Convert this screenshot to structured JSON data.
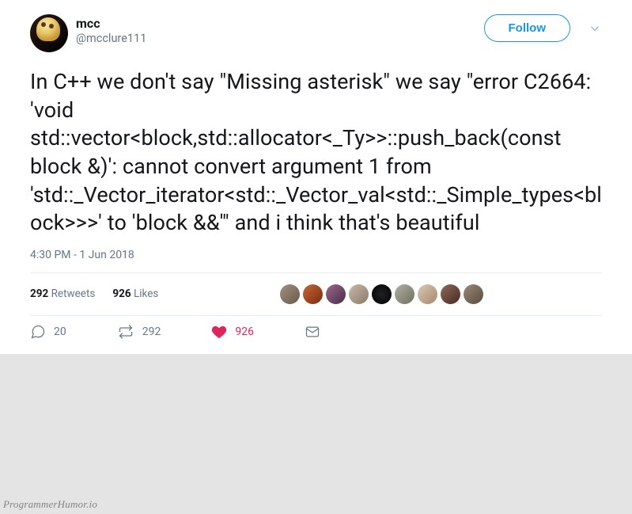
{
  "header": {
    "display_name": "mcc",
    "handle": "@mcclure111",
    "follow_label": "Follow"
  },
  "tweet": {
    "text": "In C++ we don't say \"Missing asterisk\" we say \"error C2664: 'void std::vector<block,std::allocator<_Ty>>::push_back(const block &)': cannot convert argument 1 from 'std::_Vector_iterator<std::_Vector_val<std::_Simple_types<block>>>' to 'block &&'\" and i think that's beautiful",
    "timestamp": "4:30 PM - 1 Jun 2018"
  },
  "stats": {
    "retweets_count": "292",
    "retweets_label": "Retweets",
    "likes_count": "926",
    "likes_label": "Likes"
  },
  "liker_avatars": [
    {
      "bg": "linear-gradient(135deg,#a09080,#6a5a4a)"
    },
    {
      "bg": "linear-gradient(135deg,#c86838,#7a2a10)"
    },
    {
      "bg": "linear-gradient(135deg,#9a6a8a,#4a2a4a)"
    },
    {
      "bg": "linear-gradient(135deg,#c8b8a8,#8a7a6a)"
    },
    {
      "bg": "radial-gradient(circle,#222,#000)"
    },
    {
      "bg": "linear-gradient(135deg,#b0b0a0,#707060)"
    },
    {
      "bg": "linear-gradient(135deg,#d8c8b8,#a8886a)"
    },
    {
      "bg": "linear-gradient(135deg,#8a6a5a,#4a2a20)"
    },
    {
      "bg": "linear-gradient(135deg,#9a8a7a,#5a4a3a)"
    }
  ],
  "actions": {
    "replies": "20",
    "retweets": "292",
    "likes": "926"
  },
  "watermark": "ProgrammerHumor.io"
}
